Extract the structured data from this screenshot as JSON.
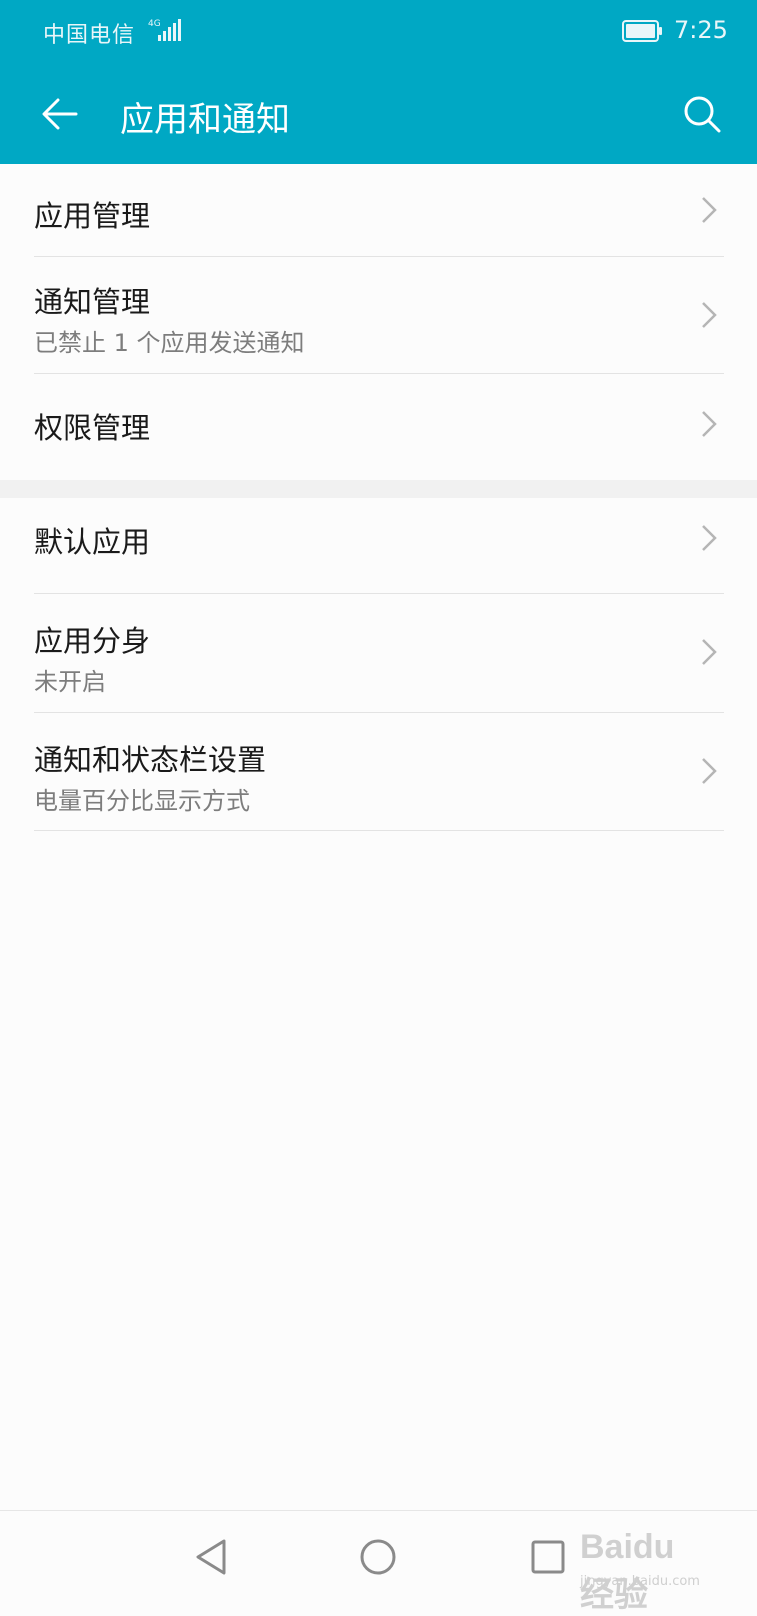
{
  "status_bar": {
    "carrier": "中国电信",
    "network": "4G",
    "time": "7:25"
  },
  "header": {
    "title": "应用和通知",
    "back_icon": "back-arrow-icon",
    "search_icon": "search-icon"
  },
  "groups": [
    {
      "items": [
        {
          "title": "应用管理",
          "subtitle": ""
        },
        {
          "title": "通知管理",
          "subtitle": "已禁止 1 个应用发送通知"
        },
        {
          "title": "权限管理",
          "subtitle": ""
        }
      ]
    },
    {
      "items": [
        {
          "title": "默认应用",
          "subtitle": ""
        },
        {
          "title": "应用分身",
          "subtitle": "未开启"
        },
        {
          "title": "通知和状态栏设置",
          "subtitle": "电量百分比显示方式"
        }
      ]
    }
  ],
  "nav_bar": {
    "back": "triangle-back-icon",
    "home": "circle-home-icon",
    "recents": "square-recents-icon"
  },
  "watermark": {
    "text": "Baidu经验",
    "url": "jingyan.baidu.com"
  },
  "colors": {
    "header_bg": "#00a8c4",
    "text_primary": "#1a1a1a",
    "text_secondary": "#7d7d7d"
  }
}
